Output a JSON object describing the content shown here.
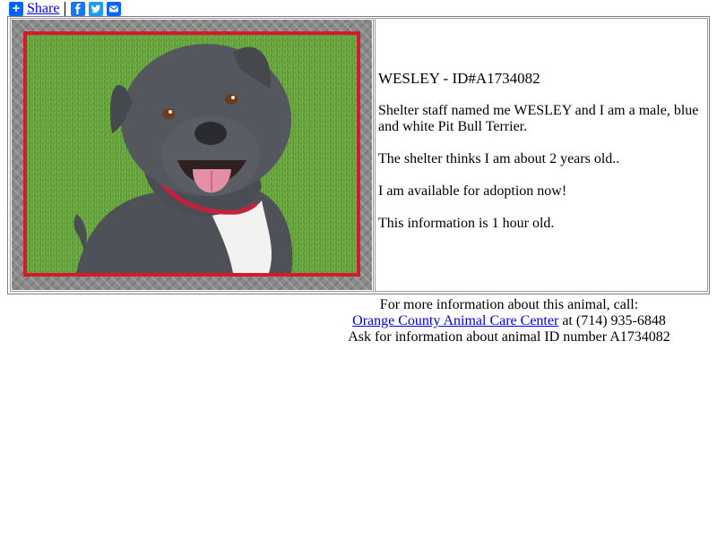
{
  "share": {
    "label": "Share",
    "icons": [
      "plus-icon",
      "facebook-icon",
      "twitter-icon",
      "email-icon"
    ],
    "colors": {
      "plus": "#0166ff",
      "facebook": "#1877f2",
      "twitter": "#1d9bf0",
      "email": "#0166ff"
    }
  },
  "animal": {
    "title": "WESLEY - ID#A1734082",
    "description": "Shelter staff named me WESLEY and I am a male, blue and white Pit Bull Terrier.",
    "age": "The shelter thinks I am about 2 years old..",
    "availability": "I am available for adoption now!",
    "freshness": "This information is 1 hour old.",
    "photo_frame_color": "#d51a2c"
  },
  "contact": {
    "line1": "For more information about this animal, call:",
    "shelter_name": "Orange County Animal Care Center",
    "phone_text": " at (714) 935-6848",
    "line3": "Ask for information about animal ID number A1734082"
  }
}
